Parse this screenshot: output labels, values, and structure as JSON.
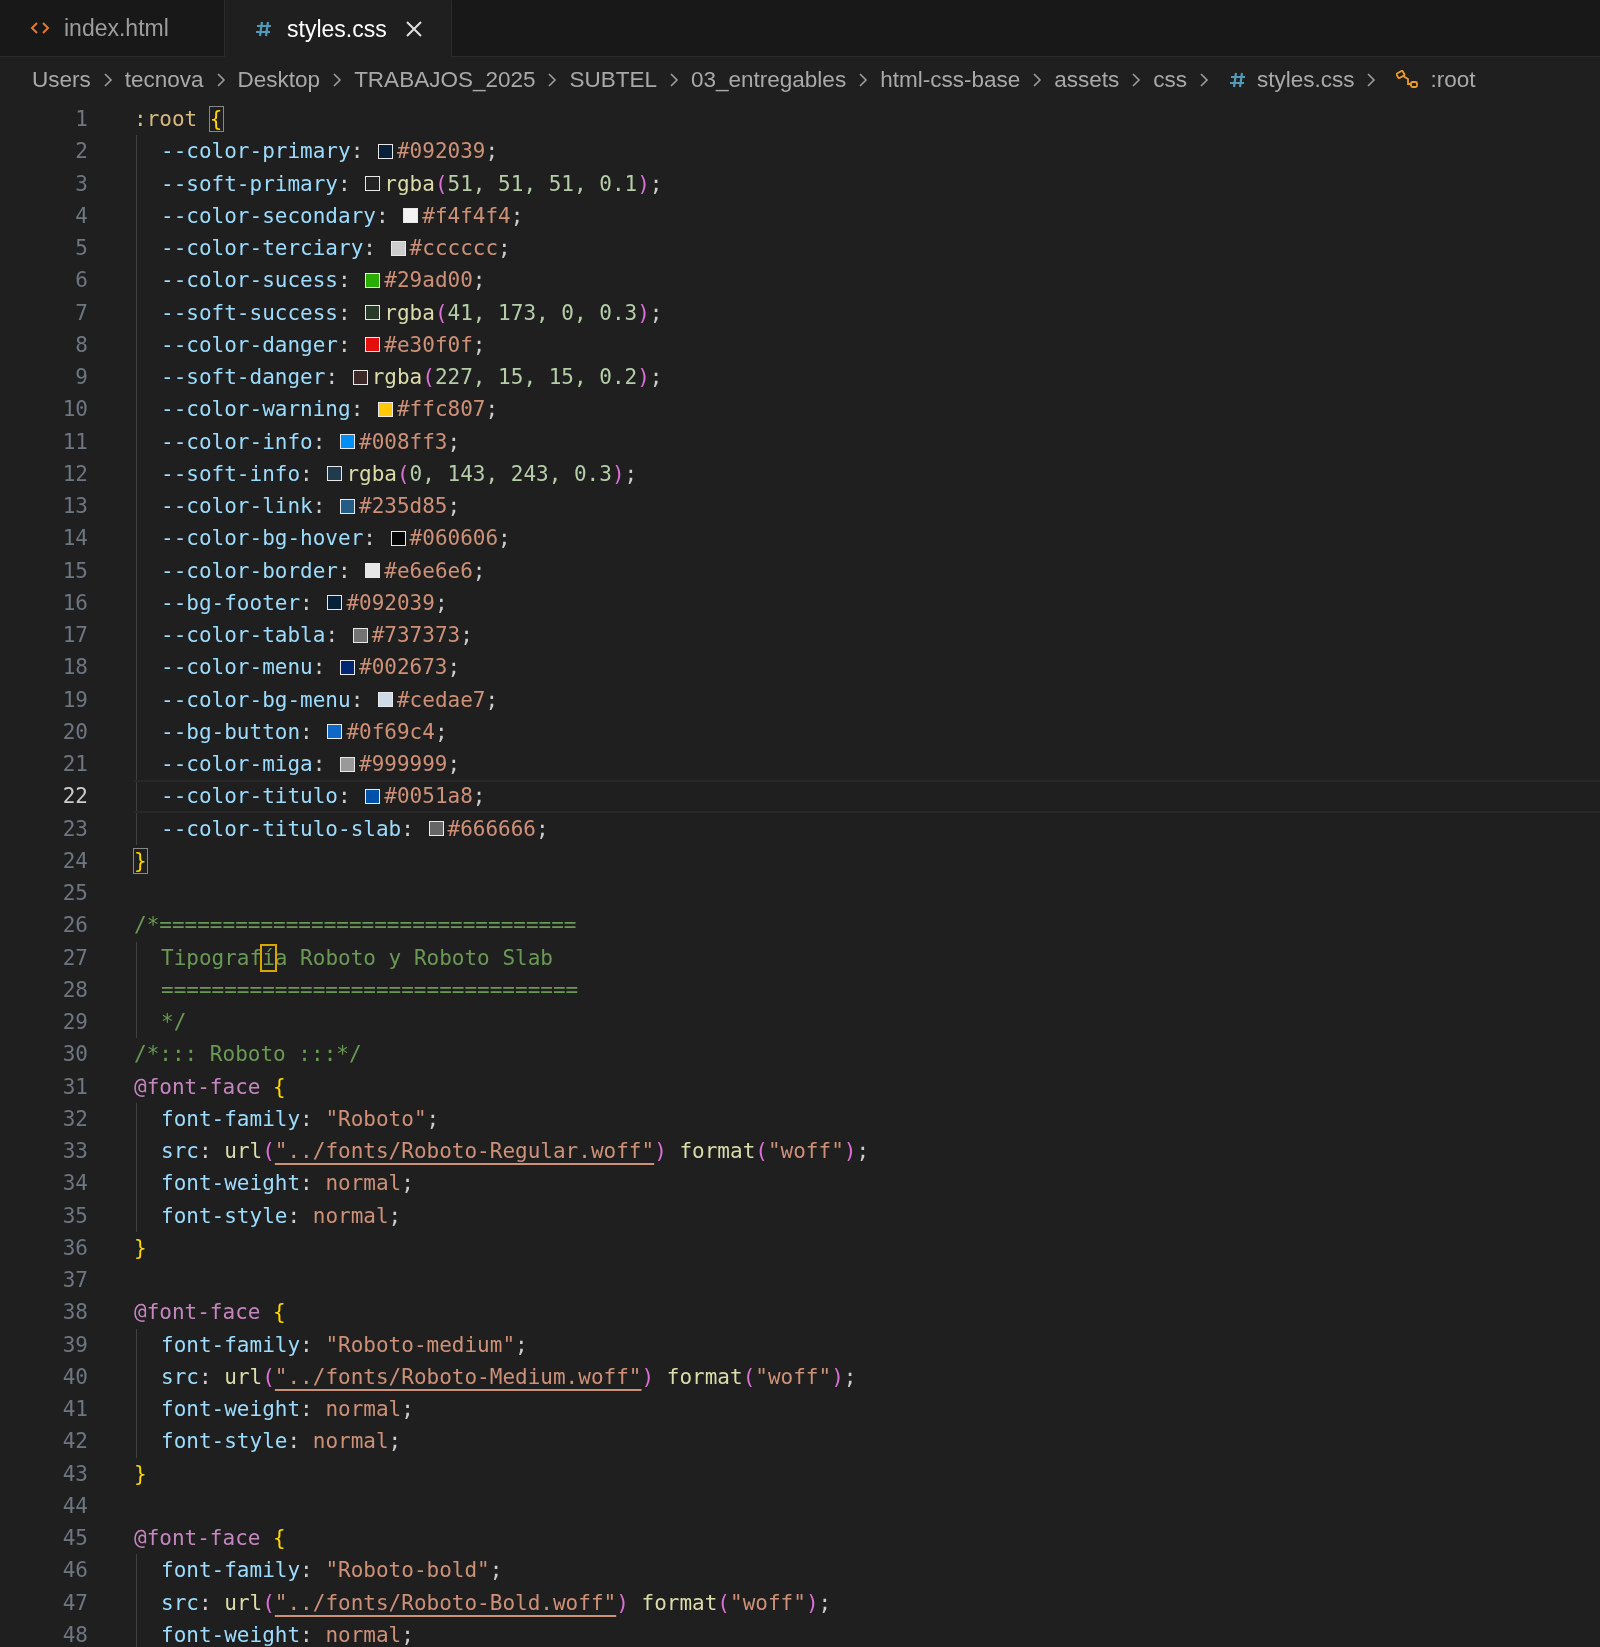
{
  "tabs": [
    {
      "label": "index.html",
      "kind": "html",
      "selected": false,
      "closable": false
    },
    {
      "label": "styles.css",
      "kind": "css",
      "selected": true,
      "closable": true
    }
  ],
  "breadcrumb": [
    {
      "label": "Users",
      "kind": "folder"
    },
    {
      "label": "tecnova",
      "kind": "folder"
    },
    {
      "label": "Desktop",
      "kind": "folder"
    },
    {
      "label": "TRABAJOS_2025",
      "kind": "folder"
    },
    {
      "label": "SUBTEL",
      "kind": "folder"
    },
    {
      "label": "03_entregables",
      "kind": "folder"
    },
    {
      "label": "html-css-base",
      "kind": "folder"
    },
    {
      "label": "assets",
      "kind": "folder"
    },
    {
      "label": "css",
      "kind": "folder"
    },
    {
      "label": "styles.css",
      "kind": "file"
    },
    {
      "label": ":root",
      "kind": "symbol"
    }
  ],
  "code": {
    "lines": [
      {
        "number": "1",
        "current": false,
        "indented": false,
        "tokens": [
          {
            "kind": "selector",
            "text": ":root "
          },
          {
            "kind": "brace",
            "text": "{",
            "matched": true
          }
        ]
      },
      {
        "number": "2",
        "current": false,
        "indented": true,
        "tokens": [
          {
            "kind": "prop",
            "text": "--color-primary"
          },
          {
            "kind": "punct",
            "text": ": "
          },
          {
            "kind": "swatch",
            "color": "#092039"
          },
          {
            "kind": "hex",
            "text": "#092039"
          },
          {
            "kind": "punct",
            "text": ";"
          }
        ]
      },
      {
        "number": "3",
        "current": false,
        "indented": true,
        "tokens": [
          {
            "kind": "prop",
            "text": "--soft-primary"
          },
          {
            "kind": "punct",
            "text": ": "
          },
          {
            "kind": "swatch",
            "color": "#242424"
          },
          {
            "kind": "fn",
            "text": "rgba"
          },
          {
            "kind": "paren",
            "text": "("
          },
          {
            "kind": "num",
            "text": "51, 51, 51, 0.1"
          },
          {
            "kind": "paren",
            "text": ")"
          },
          {
            "kind": "punct",
            "text": ";"
          }
        ]
      },
      {
        "number": "4",
        "current": false,
        "indented": true,
        "tokens": [
          {
            "kind": "prop",
            "text": "--color-secondary"
          },
          {
            "kind": "punct",
            "text": ": "
          },
          {
            "kind": "swatch",
            "color": "#f4f4f4"
          },
          {
            "kind": "hex",
            "text": "#f4f4f4"
          },
          {
            "kind": "punct",
            "text": ";"
          }
        ]
      },
      {
        "number": "5",
        "current": false,
        "indented": true,
        "tokens": [
          {
            "kind": "prop",
            "text": "--color-terciary"
          },
          {
            "kind": "punct",
            "text": ": "
          },
          {
            "kind": "swatch",
            "color": "#cccccc"
          },
          {
            "kind": "hex",
            "text": "#cccccc"
          },
          {
            "kind": "punct",
            "text": ";"
          }
        ]
      },
      {
        "number": "6",
        "current": false,
        "indented": true,
        "tokens": [
          {
            "kind": "prop",
            "text": "--color-sucess"
          },
          {
            "kind": "punct",
            "text": ": "
          },
          {
            "kind": "swatch",
            "color": "#29ad00"
          },
          {
            "kind": "hex",
            "text": "#29ad00"
          },
          {
            "kind": "punct",
            "text": ";"
          }
        ]
      },
      {
        "number": "7",
        "current": false,
        "indented": true,
        "tokens": [
          {
            "kind": "prop",
            "text": "--soft-success"
          },
          {
            "kind": "punct",
            "text": ": "
          },
          {
            "kind": "swatch",
            "color": "#283a28"
          },
          {
            "kind": "fn",
            "text": "rgba"
          },
          {
            "kind": "paren",
            "text": "("
          },
          {
            "kind": "num",
            "text": "41, 173, 0, 0.3"
          },
          {
            "kind": "paren",
            "text": ")"
          },
          {
            "kind": "punct",
            "text": ";"
          }
        ]
      },
      {
        "number": "8",
        "current": false,
        "indented": true,
        "tokens": [
          {
            "kind": "prop",
            "text": "--color-danger"
          },
          {
            "kind": "punct",
            "text": ": "
          },
          {
            "kind": "swatch",
            "color": "#e30f0f"
          },
          {
            "kind": "hex",
            "text": "#e30f0f"
          },
          {
            "kind": "punct",
            "text": ";"
          }
        ]
      },
      {
        "number": "9",
        "current": false,
        "indented": true,
        "tokens": [
          {
            "kind": "prop",
            "text": "--soft-danger"
          },
          {
            "kind": "punct",
            "text": ": "
          },
          {
            "kind": "swatch",
            "color": "#3e2828"
          },
          {
            "kind": "fn",
            "text": "rgba"
          },
          {
            "kind": "paren",
            "text": "("
          },
          {
            "kind": "num",
            "text": "227, 15, 15, 0.2"
          },
          {
            "kind": "paren",
            "text": ")"
          },
          {
            "kind": "punct",
            "text": ";"
          }
        ]
      },
      {
        "number": "10",
        "current": false,
        "indented": true,
        "tokens": [
          {
            "kind": "prop",
            "text": "--color-warning"
          },
          {
            "kind": "punct",
            "text": ": "
          },
          {
            "kind": "swatch",
            "color": "#ffc807"
          },
          {
            "kind": "hex",
            "text": "#ffc807"
          },
          {
            "kind": "punct",
            "text": ";"
          }
        ]
      },
      {
        "number": "11",
        "current": false,
        "indented": true,
        "tokens": [
          {
            "kind": "prop",
            "text": "--color-info"
          },
          {
            "kind": "punct",
            "text": ": "
          },
          {
            "kind": "swatch",
            "color": "#008ff3"
          },
          {
            "kind": "hex",
            "text": "#008ff3"
          },
          {
            "kind": "punct",
            "text": ";"
          }
        ]
      },
      {
        "number": "12",
        "current": false,
        "indented": true,
        "tokens": [
          {
            "kind": "prop",
            "text": "--soft-info"
          },
          {
            "kind": "punct",
            "text": ": "
          },
          {
            "kind": "swatch",
            "color": "#213a4c"
          },
          {
            "kind": "fn",
            "text": "rgba"
          },
          {
            "kind": "paren",
            "text": "("
          },
          {
            "kind": "num",
            "text": "0, 143, 243, 0.3"
          },
          {
            "kind": "paren",
            "text": ")"
          },
          {
            "kind": "punct",
            "text": ";"
          }
        ]
      },
      {
        "number": "13",
        "current": false,
        "indented": true,
        "tokens": [
          {
            "kind": "prop",
            "text": "--color-link"
          },
          {
            "kind": "punct",
            "text": ": "
          },
          {
            "kind": "swatch",
            "color": "#235d85"
          },
          {
            "kind": "hex",
            "text": "#235d85"
          },
          {
            "kind": "punct",
            "text": ";"
          }
        ]
      },
      {
        "number": "14",
        "current": false,
        "indented": true,
        "tokens": [
          {
            "kind": "prop",
            "text": "--color-bg-hover"
          },
          {
            "kind": "punct",
            "text": ": "
          },
          {
            "kind": "swatch",
            "color": "#060606"
          },
          {
            "kind": "hex",
            "text": "#060606"
          },
          {
            "kind": "punct",
            "text": ";"
          }
        ]
      },
      {
        "number": "15",
        "current": false,
        "indented": true,
        "tokens": [
          {
            "kind": "prop",
            "text": "--color-border"
          },
          {
            "kind": "punct",
            "text": ": "
          },
          {
            "kind": "swatch",
            "color": "#e6e6e6"
          },
          {
            "kind": "hex",
            "text": "#e6e6e6"
          },
          {
            "kind": "punct",
            "text": ";"
          }
        ]
      },
      {
        "number": "16",
        "current": false,
        "indented": true,
        "tokens": [
          {
            "kind": "prop",
            "text": "--bg-footer"
          },
          {
            "kind": "punct",
            "text": ": "
          },
          {
            "kind": "swatch",
            "color": "#092039"
          },
          {
            "kind": "hex",
            "text": "#092039"
          },
          {
            "kind": "punct",
            "text": ";"
          }
        ]
      },
      {
        "number": "17",
        "current": false,
        "indented": true,
        "tokens": [
          {
            "kind": "prop",
            "text": "--color-tabla"
          },
          {
            "kind": "punct",
            "text": ": "
          },
          {
            "kind": "swatch",
            "color": "#737373"
          },
          {
            "kind": "hex",
            "text": "#737373"
          },
          {
            "kind": "punct",
            "text": ";"
          }
        ]
      },
      {
        "number": "18",
        "current": false,
        "indented": true,
        "tokens": [
          {
            "kind": "prop",
            "text": "--color-menu"
          },
          {
            "kind": "punct",
            "text": ": "
          },
          {
            "kind": "swatch",
            "color": "#002673"
          },
          {
            "kind": "hex",
            "text": "#002673"
          },
          {
            "kind": "punct",
            "text": ";"
          }
        ]
      },
      {
        "number": "19",
        "current": false,
        "indented": true,
        "tokens": [
          {
            "kind": "prop",
            "text": "--color-bg-menu"
          },
          {
            "kind": "punct",
            "text": ": "
          },
          {
            "kind": "swatch",
            "color": "#cedae7"
          },
          {
            "kind": "hex",
            "text": "#cedae7"
          },
          {
            "kind": "punct",
            "text": ";"
          }
        ]
      },
      {
        "number": "20",
        "current": false,
        "indented": true,
        "tokens": [
          {
            "kind": "prop",
            "text": "--bg-button"
          },
          {
            "kind": "punct",
            "text": ": "
          },
          {
            "kind": "swatch",
            "color": "#0f69c4"
          },
          {
            "kind": "hex",
            "text": "#0f69c4"
          },
          {
            "kind": "punct",
            "text": ";"
          }
        ]
      },
      {
        "number": "21",
        "current": false,
        "indented": true,
        "tokens": [
          {
            "kind": "prop",
            "text": "--color-miga"
          },
          {
            "kind": "punct",
            "text": ": "
          },
          {
            "kind": "swatch",
            "color": "#999999"
          },
          {
            "kind": "hex",
            "text": "#999999"
          },
          {
            "kind": "punct",
            "text": ";"
          }
        ]
      },
      {
        "number": "22",
        "current": true,
        "indented": true,
        "tokens": [
          {
            "kind": "prop",
            "text": "--color-titulo"
          },
          {
            "kind": "punct",
            "text": ": "
          },
          {
            "kind": "swatch",
            "color": "#0051a8"
          },
          {
            "kind": "hex",
            "text": "#0051a8"
          },
          {
            "kind": "punct",
            "text": ";"
          }
        ]
      },
      {
        "number": "23",
        "current": false,
        "indented": true,
        "tokens": [
          {
            "kind": "prop",
            "text": "--color-titulo-slab"
          },
          {
            "kind": "punct",
            "text": ": "
          },
          {
            "kind": "swatch",
            "color": "#666666"
          },
          {
            "kind": "hex",
            "text": "#666666"
          },
          {
            "kind": "punct",
            "text": ";"
          }
        ]
      },
      {
        "number": "24",
        "current": false,
        "indented": false,
        "tokens": [
          {
            "kind": "brace",
            "text": "}",
            "matched": true
          }
        ]
      },
      {
        "number": "25",
        "current": false
      },
      {
        "number": "26",
        "current": false,
        "indented": false,
        "tokens": [
          {
            "kind": "comment",
            "text": "/*================================="
          }
        ]
      },
      {
        "number": "27",
        "current": false,
        "indented": true,
        "tokens": [
          {
            "kind": "comment",
            "text": "Tipograf"
          },
          {
            "kind": "comment",
            "text": "í",
            "cursor": true
          },
          {
            "kind": "comment",
            "text": "a Roboto y Roboto Slab"
          }
        ]
      },
      {
        "number": "28",
        "current": false,
        "indented": true,
        "tokens": [
          {
            "kind": "comment",
            "text": "================================="
          }
        ]
      },
      {
        "number": "29",
        "current": false,
        "indented": true,
        "tokens": [
          {
            "kind": "comment",
            "text": "*/"
          }
        ]
      },
      {
        "number": "30",
        "current": false,
        "indented": false,
        "tokens": [
          {
            "kind": "comment",
            "text": "/*::: Roboto :::*/"
          }
        ]
      },
      {
        "number": "31",
        "current": false,
        "indented": false,
        "tokens": [
          {
            "kind": "at",
            "text": "@font-face "
          },
          {
            "kind": "brace",
            "text": "{"
          }
        ]
      },
      {
        "number": "32",
        "current": false,
        "indented": true,
        "tokens": [
          {
            "kind": "prop",
            "text": "font-family"
          },
          {
            "kind": "punct",
            "text": ": "
          },
          {
            "kind": "string",
            "text": "\"Roboto\""
          },
          {
            "kind": "punct",
            "text": ";"
          }
        ]
      },
      {
        "number": "33",
        "current": false,
        "indented": true,
        "tokens": [
          {
            "kind": "prop",
            "text": "src"
          },
          {
            "kind": "punct",
            "text": ": "
          },
          {
            "kind": "fn",
            "text": "url"
          },
          {
            "kind": "paren",
            "text": "("
          },
          {
            "kind": "link",
            "text": "\"../fonts/Roboto-Regular.woff\""
          },
          {
            "kind": "paren",
            "text": ") "
          },
          {
            "kind": "fn",
            "text": "format"
          },
          {
            "kind": "paren",
            "text": "("
          },
          {
            "kind": "string",
            "text": "\"woff\""
          },
          {
            "kind": "paren",
            "text": ")"
          },
          {
            "kind": "punct",
            "text": ";"
          }
        ]
      },
      {
        "number": "34",
        "current": false,
        "indented": true,
        "tokens": [
          {
            "kind": "prop",
            "text": "font-weight"
          },
          {
            "kind": "punct",
            "text": ": "
          },
          {
            "kind": "string",
            "text": "normal"
          },
          {
            "kind": "punct",
            "text": ";"
          }
        ]
      },
      {
        "number": "35",
        "current": false,
        "indented": true,
        "tokens": [
          {
            "kind": "prop",
            "text": "font-style"
          },
          {
            "kind": "punct",
            "text": ": "
          },
          {
            "kind": "string",
            "text": "normal"
          },
          {
            "kind": "punct",
            "text": ";"
          }
        ]
      },
      {
        "number": "36",
        "current": false,
        "indented": false,
        "tokens": [
          {
            "kind": "brace",
            "text": "}"
          }
        ]
      },
      {
        "number": "37",
        "current": false
      },
      {
        "number": "38",
        "current": false,
        "indented": false,
        "tokens": [
          {
            "kind": "at",
            "text": "@font-face "
          },
          {
            "kind": "brace",
            "text": "{"
          }
        ]
      },
      {
        "number": "39",
        "current": false,
        "indented": true,
        "tokens": [
          {
            "kind": "prop",
            "text": "font-family"
          },
          {
            "kind": "punct",
            "text": ": "
          },
          {
            "kind": "string",
            "text": "\"Roboto-medium\""
          },
          {
            "kind": "punct",
            "text": ";"
          }
        ]
      },
      {
        "number": "40",
        "current": false,
        "indented": true,
        "tokens": [
          {
            "kind": "prop",
            "text": "src"
          },
          {
            "kind": "punct",
            "text": ": "
          },
          {
            "kind": "fn",
            "text": "url"
          },
          {
            "kind": "paren",
            "text": "("
          },
          {
            "kind": "link",
            "text": "\"../fonts/Roboto-Medium.woff\""
          },
          {
            "kind": "paren",
            "text": ") "
          },
          {
            "kind": "fn",
            "text": "format"
          },
          {
            "kind": "paren",
            "text": "("
          },
          {
            "kind": "string",
            "text": "\"woff\""
          },
          {
            "kind": "paren",
            "text": ")"
          },
          {
            "kind": "punct",
            "text": ";"
          }
        ]
      },
      {
        "number": "41",
        "current": false,
        "indented": true,
        "tokens": [
          {
            "kind": "prop",
            "text": "font-weight"
          },
          {
            "kind": "punct",
            "text": ": "
          },
          {
            "kind": "string",
            "text": "normal"
          },
          {
            "kind": "punct",
            "text": ";"
          }
        ]
      },
      {
        "number": "42",
        "current": false,
        "indented": true,
        "tokens": [
          {
            "kind": "prop",
            "text": "font-style"
          },
          {
            "kind": "punct",
            "text": ": "
          },
          {
            "kind": "string",
            "text": "normal"
          },
          {
            "kind": "punct",
            "text": ";"
          }
        ]
      },
      {
        "number": "43",
        "current": false,
        "indented": false,
        "tokens": [
          {
            "kind": "brace",
            "text": "}"
          }
        ]
      },
      {
        "number": "44",
        "current": false
      },
      {
        "number": "45",
        "current": false,
        "indented": false,
        "tokens": [
          {
            "kind": "at",
            "text": "@font-face "
          },
          {
            "kind": "brace",
            "text": "{"
          }
        ]
      },
      {
        "number": "46",
        "current": false,
        "indented": true,
        "tokens": [
          {
            "kind": "prop",
            "text": "font-family"
          },
          {
            "kind": "punct",
            "text": ": "
          },
          {
            "kind": "string",
            "text": "\"Roboto-bold\""
          },
          {
            "kind": "punct",
            "text": ";"
          }
        ]
      },
      {
        "number": "47",
        "current": false,
        "indented": true,
        "tokens": [
          {
            "kind": "prop",
            "text": "src"
          },
          {
            "kind": "punct",
            "text": ": "
          },
          {
            "kind": "fn",
            "text": "url"
          },
          {
            "kind": "paren",
            "text": "("
          },
          {
            "kind": "link",
            "text": "\"../fonts/Roboto-Bold.woff\""
          },
          {
            "kind": "paren",
            "text": ") "
          },
          {
            "kind": "fn",
            "text": "format"
          },
          {
            "kind": "paren",
            "text": "("
          },
          {
            "kind": "string",
            "text": "\"woff\""
          },
          {
            "kind": "paren",
            "text": ")"
          },
          {
            "kind": "punct",
            "text": ";"
          }
        ]
      },
      {
        "number": "48",
        "current": false,
        "indented": true,
        "tokens": [
          {
            "kind": "prop",
            "text": "font-weight"
          },
          {
            "kind": "punct",
            "text": ": "
          },
          {
            "kind": "string",
            "text": "normal"
          },
          {
            "kind": "punct",
            "text": ";"
          }
        ]
      }
    ]
  }
}
